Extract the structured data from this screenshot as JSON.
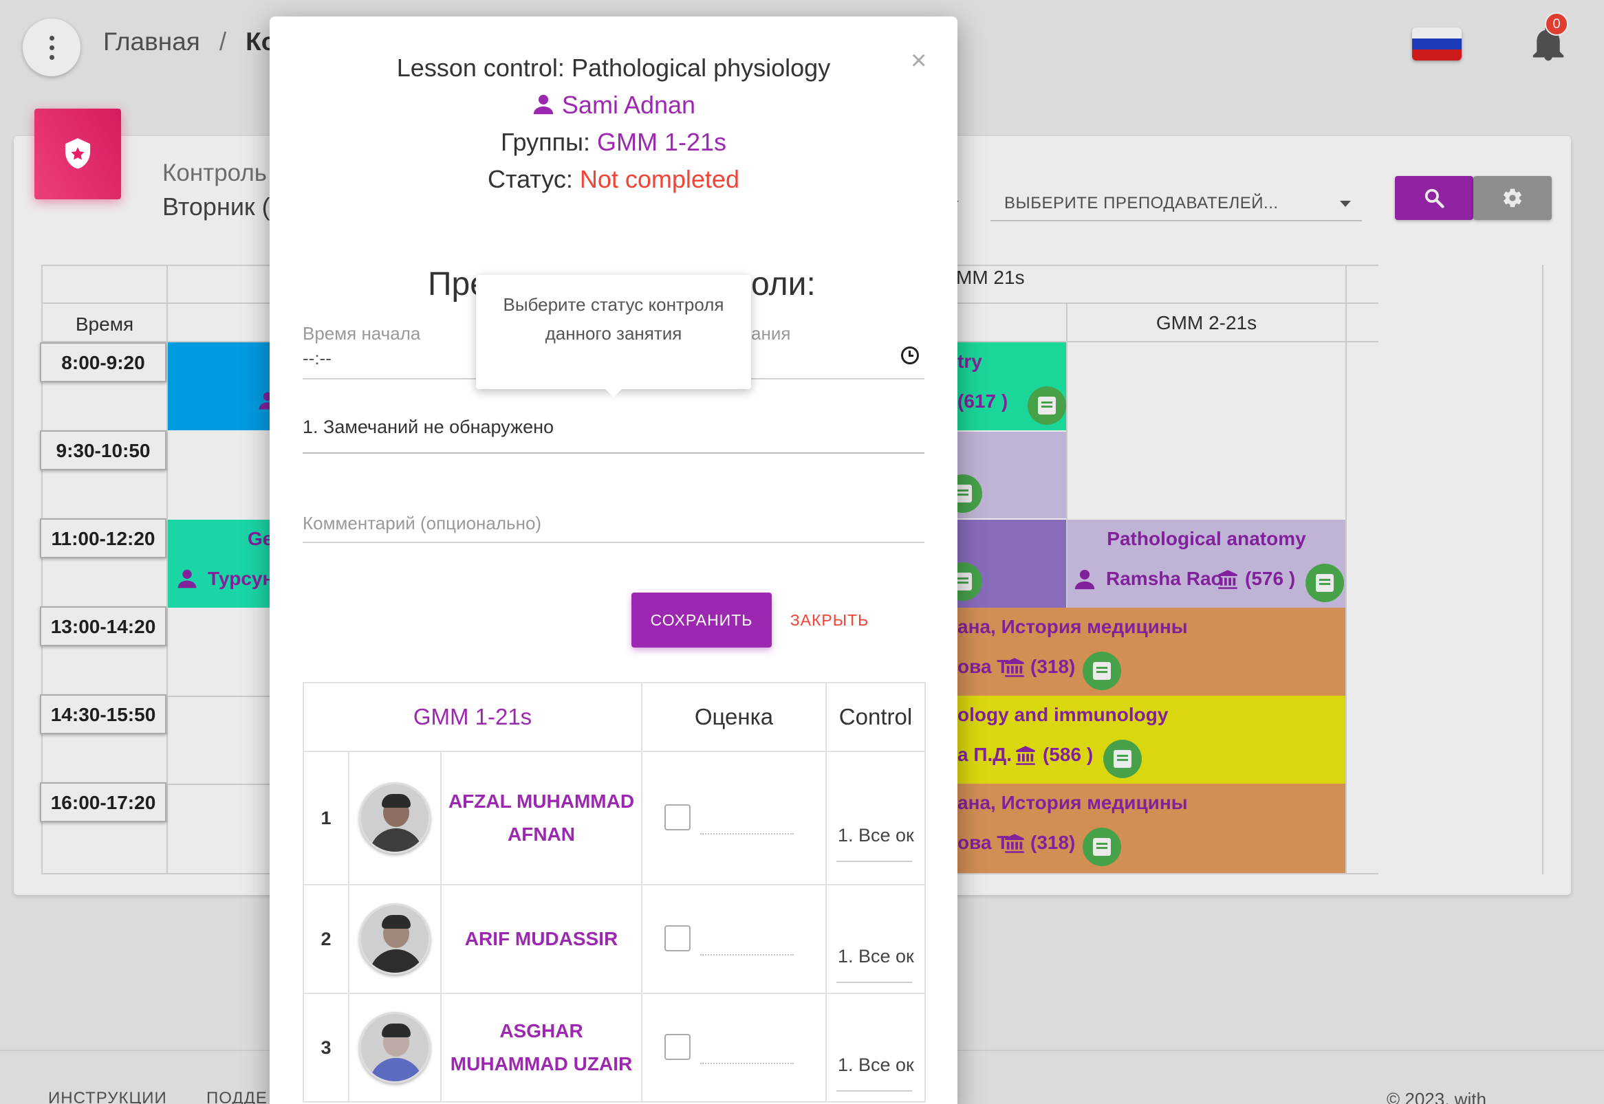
{
  "nav": {
    "breadcrumb_home": "Главная",
    "breadcrumb_sep": "/",
    "breadcrumb_current": "Ко",
    "notifications_count": "0",
    "flag_colors": [
      "#ffffff",
      "#1e40c8",
      "#e01d1d"
    ]
  },
  "page": {
    "card_title": "Контроль",
    "card_subtitle": "Вторник (",
    "teacher_select_placeholder": "ВЫБЕРИТЕ ПРЕПОДАВАТЕЛЕЙ...",
    "accent_color": "#9c27b0",
    "time_header": "Время",
    "group_header": "MM 21s",
    "subgroup_header": "GMM 2-21s",
    "times": [
      "8:00-9:20",
      "9:30-10:50",
      "11:00-12:20",
      "13:00-14:20",
      "14:30-15:50",
      "16:00-17:20"
    ],
    "lessons": {
      "l1_title": "try",
      "l1_room": "(617 )",
      "l2_title": "Ge",
      "l2_teacher": "Турсун",
      "l3_title": "Pathological anatomy",
      "l3_teacher": "Ramsha Rao",
      "l3_room": "(576 )",
      "l4_title": "ана, История медицины",
      "l4_teacher": "ова Т",
      "l4_room": "(318)",
      "l5_title": "ology and immunology",
      "l5_teacher": "а П.Д.",
      "l5_room": "(586 )",
      "l6_title": "ана, История медицины",
      "l6_teacher": "ова Т",
      "l6_room": "(318)"
    },
    "footer_left_1": "ИНСТРУКЦИИ",
    "footer_left_2": "ПОДДЕ",
    "footer_right": "© 2023, with"
  },
  "modal": {
    "title_prefix": "Lesson control:",
    "title_subject": "Pathological physiology",
    "teacher_name": "Sami Adnan",
    "groups_label": "Группы:",
    "groups_value": "GMM 1-21s",
    "status_label": "Статус:",
    "status_value": "Not completed",
    "section_title_start": "Пре",
    "section_title_end": "оли:",
    "start_time_label": "Время начала",
    "start_time_value": "--:--",
    "end_time_label": "ания",
    "tooltip_text": "Выберите статус контроля данного занятия",
    "status_select_value": "1. Замечаний не обнаружено",
    "comment_placeholder": "Комментарий (опционально)",
    "save_button": "СОХРАНИТЬ",
    "close_button": "ЗАКРЫТЬ",
    "close_icon": "×",
    "table": {
      "headers": [
        "GMM 1-21s",
        "Оценка",
        "Control"
      ],
      "rows": [
        {
          "num": "1",
          "name": "AFZAL MUHAMMAD AFNAN",
          "control": "1. Все ок"
        },
        {
          "num": "2",
          "name": "ARIF MUDASSIR",
          "control": "1. Все ок"
        },
        {
          "num": "3",
          "name": "ASGHAR MUHAMMAD UZAIR",
          "control": "1. Все ок"
        }
      ]
    }
  }
}
